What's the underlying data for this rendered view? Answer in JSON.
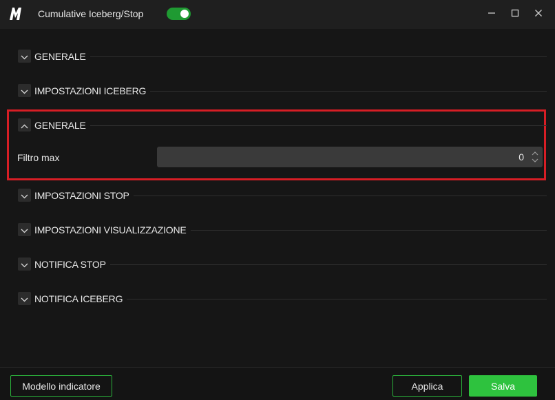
{
  "window": {
    "title": "Cumulative Iceberg/Stop",
    "toggle_on": true,
    "accent_color": "#1f9a32",
    "highlight_color": "#d71e25"
  },
  "icons": {
    "logo": "m-logo-icon",
    "minimize": "minimize-icon",
    "maximize": "maximize-icon",
    "close": "close-icon",
    "collapsed": "chevron-down-icon",
    "expanded": "chevron-up-icon",
    "spinner": "spinner-arrows-icon"
  },
  "sections": [
    {
      "label": "GENERALE",
      "expanded": false
    },
    {
      "label": "IMPOSTAZIONI ICEBERG",
      "expanded": false
    },
    {
      "label": "GENERALE",
      "expanded": true
    },
    {
      "label": "IMPOSTAZIONI STOP",
      "expanded": false
    },
    {
      "label": "IMPOSTAZIONI VISUALIZZAZIONE",
      "expanded": false
    },
    {
      "label": "NOTIFICA STOP",
      "expanded": false
    },
    {
      "label": "NOTIFICA ICEBERG",
      "expanded": false
    }
  ],
  "fields": {
    "filtro_max": {
      "label": "Filtro max",
      "value": "0"
    }
  },
  "footer": {
    "template_button": "Modello indicatore",
    "apply_button": "Applica",
    "save_button": "Salva"
  }
}
